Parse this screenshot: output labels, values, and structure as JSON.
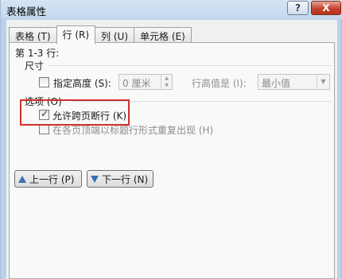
{
  "window": {
    "title": "表格属性",
    "help_label": "?",
    "close_label": "X"
  },
  "tabs": [
    {
      "label": "表格 (T)"
    },
    {
      "label": "行 (R)"
    },
    {
      "label": "列 (U)"
    },
    {
      "label": "单元格 (E)"
    }
  ],
  "active_tab": "行 (R)",
  "rows_label": "第 1-3 行:",
  "size": {
    "section_label": "尺寸",
    "specify_height_label": "指定高度 (S):",
    "specify_height_checked": false,
    "height_value": "0 厘米",
    "height_rule_label": "行高值是 (I):",
    "height_rule_value": "最小值"
  },
  "options": {
    "section_label": "选项 (O)",
    "allow_break_label": "允许跨页断行 (K)",
    "allow_break_checked": true,
    "repeat_header_label": "在各页顶端以标题行形式重复出现 (H)",
    "repeat_header_checked": false
  },
  "buttons": {
    "prev_row": "上一行 (P)",
    "next_row": "下一行 (N)"
  },
  "colors": {
    "highlight": "#d0312d",
    "title_bar": "#c3d7ec",
    "arrow": "#3b6fb5"
  }
}
